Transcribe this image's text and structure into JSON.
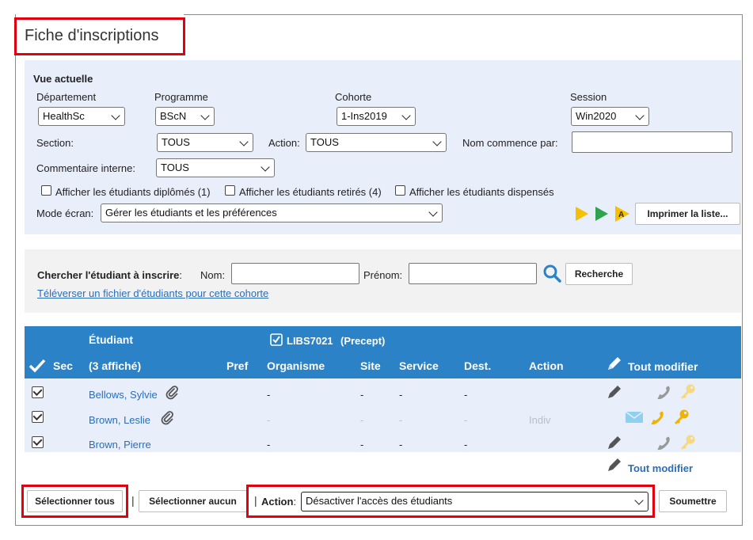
{
  "page": {
    "title": "Fiche d'inscriptions"
  },
  "filters": {
    "heading": "Vue actuelle",
    "departement": {
      "label": "Département",
      "value": "HealthSc"
    },
    "programme": {
      "label": "Programme",
      "value": "BScN"
    },
    "cohorte": {
      "label": "Cohorte",
      "value": "1-Ins2019"
    },
    "session": {
      "label": "Session",
      "value": "Win2020"
    },
    "section": {
      "label": "Section:",
      "value": "TOUS"
    },
    "action": {
      "label": "Action:",
      "value": "TOUS"
    },
    "nom_commence": {
      "label": "Nom commence par:",
      "value": ""
    },
    "commentaire": {
      "label": "Commentaire interne:",
      "value": "TOUS"
    },
    "checkboxes": [
      "Afficher les étudiants diplômés (1)",
      "Afficher les étudiants retirés (4)",
      "Afficher les étudiants dispensés"
    ],
    "mode_ecran": {
      "label": "Mode écran:",
      "value": "Gérer les étudiants et les préférences"
    },
    "print_button": "Imprimer la liste...",
    "colors": {
      "play_yellow": "#f5c000",
      "play_green": "#2ea44f"
    }
  },
  "search": {
    "label": "Chercher l'étudiant à inscrire",
    "colon": ":",
    "nom_label": "Nom:",
    "prenom_label": "Prénom:",
    "button": "Recherche",
    "upload_link": "Téléverser un fichier d'étudiants pour cette cohorte"
  },
  "table": {
    "course": "LIBS7021",
    "course_tag": "(Precept)",
    "col_sec": "Sec",
    "col_etudiant": "Étudiant",
    "col_count": "(3 affiché)",
    "col_pref": "Pref",
    "col_organisme": "Organisme",
    "col_site": "Site",
    "col_service": "Service",
    "col_dest": "Dest.",
    "col_action": "Action",
    "edit_all": "Tout modifier",
    "rows": [
      {
        "name": "Bellows, Sylvie",
        "organisme": "-",
        "site": "-",
        "service": "-",
        "dest": "-",
        "action": ""
      },
      {
        "name": "Brown, Leslie",
        "organisme": "-",
        "site": "-",
        "service": "-",
        "dest": "-",
        "action": "Indiv"
      },
      {
        "name": "Brown, Pierre",
        "organisme": "-",
        "site": "-",
        "service": "-",
        "dest": "-",
        "action": ""
      }
    ],
    "edit_all_bottom": "Tout modifier"
  },
  "bottom": {
    "select_all": "Sélectionner tous",
    "select_none": "Sélectionner aucun",
    "pipe": "|",
    "action_label": "Action",
    "action_colon": ":",
    "action_value": "Désactiver l'accès des étudiants",
    "submit": "Soumettre"
  },
  "colors": {
    "accent": "#2b82c6",
    "highlight": "#e3000f",
    "link": "#2a6ebb",
    "key": "#f0b400"
  }
}
